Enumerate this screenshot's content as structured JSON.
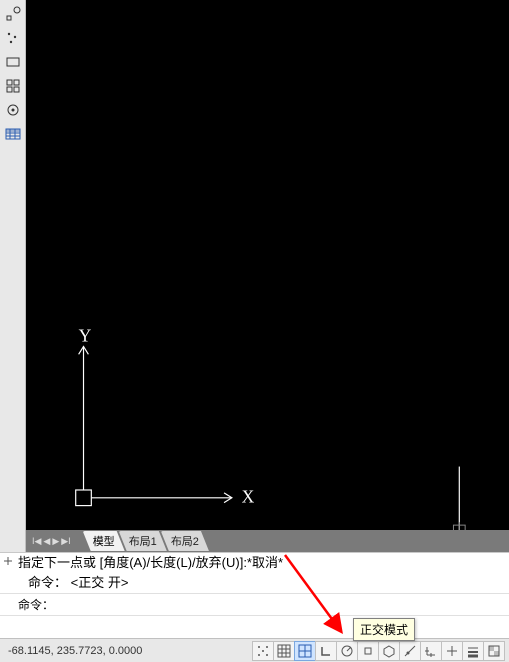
{
  "ucs": {
    "x_label": "X",
    "y_label": "Y"
  },
  "tabs": {
    "items": [
      "模型",
      "布局1",
      "布局2"
    ],
    "active": 0
  },
  "command": {
    "history_line1": "指定下一点或  [角度(A)/长度(L)/放弃(U)]:*取消*",
    "history_line2": "命令：  <正交 开>",
    "prompt_label": "命令：",
    "input_value": ""
  },
  "status": {
    "coords": "-68.1145,  235.7723,  0.0000",
    "tooltip": "正交模式",
    "buttons": [
      {
        "name": "infer-constraints",
        "icon": "grid-dots",
        "active": false
      },
      {
        "name": "snap-mode",
        "icon": "snap",
        "active": false
      },
      {
        "name": "grid-display",
        "icon": "grid",
        "active": true
      },
      {
        "name": "ortho-mode",
        "icon": "ortho",
        "active": false
      },
      {
        "name": "polar-tracking",
        "icon": "polar",
        "active": false
      },
      {
        "name": "object-snap",
        "icon": "osnap",
        "active": false
      },
      {
        "name": "3d-osnap",
        "icon": "osnap3d",
        "active": false
      },
      {
        "name": "otrack",
        "icon": "otrack",
        "active": false
      },
      {
        "name": "ducs",
        "icon": "ducs",
        "active": false
      },
      {
        "name": "dyn-input",
        "icon": "dyn",
        "active": false
      },
      {
        "name": "lineweight",
        "icon": "lwt",
        "active": false
      },
      {
        "name": "transparency",
        "icon": "tpy",
        "active": false
      }
    ]
  },
  "left_tools": [
    {
      "name": "ucs-icon-tool",
      "glyph": "ucs"
    },
    {
      "name": "points-tool",
      "glyph": "dots"
    },
    {
      "name": "rect-tool",
      "glyph": "rect"
    },
    {
      "name": "grid-tool",
      "glyph": "grid4"
    },
    {
      "name": "target-tool",
      "glyph": "target"
    },
    {
      "name": "table-tool",
      "glyph": "table"
    }
  ],
  "colors": {
    "tooltip_bg": "#ffffe1",
    "arrow_red": "#ff0000",
    "active_btn": "#cfe4ff"
  }
}
